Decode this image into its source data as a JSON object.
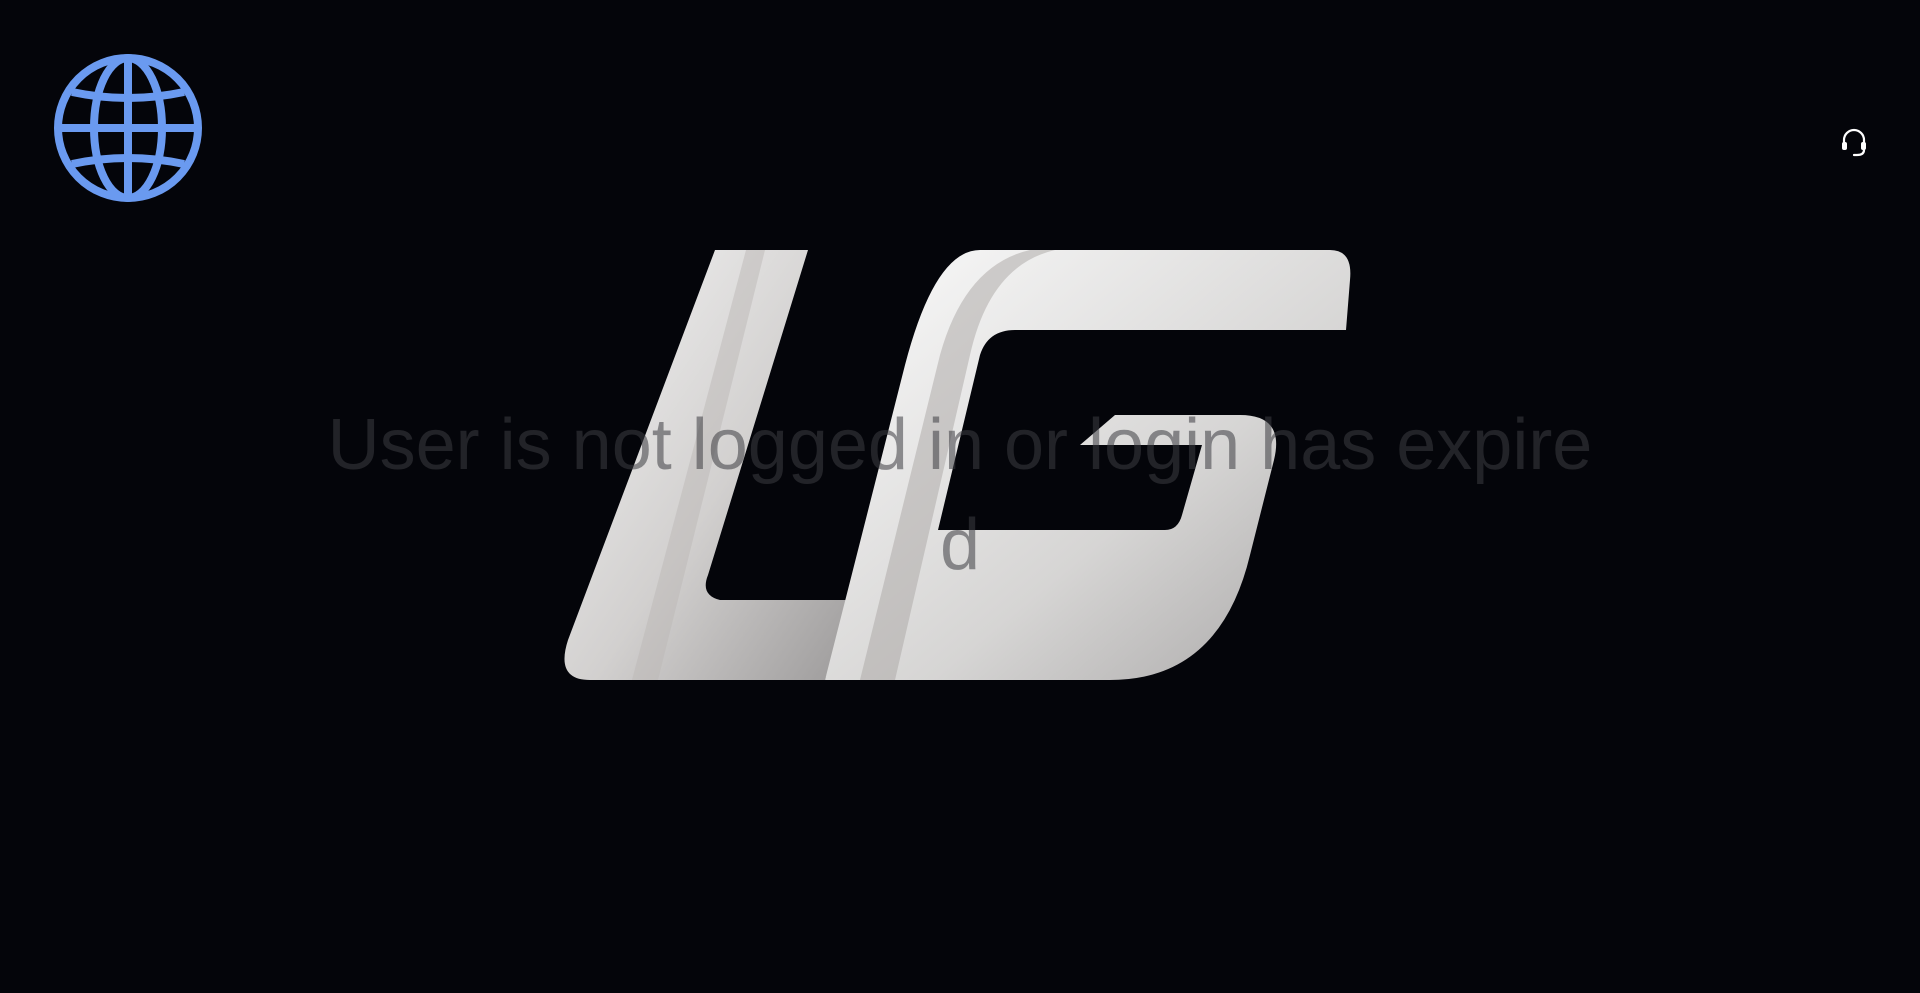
{
  "header": {
    "language_icon": "globe-icon",
    "support_icon": "headset-icon"
  },
  "colors": {
    "background": "#04050a",
    "globe": "#6a9af0",
    "message_text": "#3c3c42"
  },
  "message": {
    "text": "User is not logged in or login has expired"
  }
}
